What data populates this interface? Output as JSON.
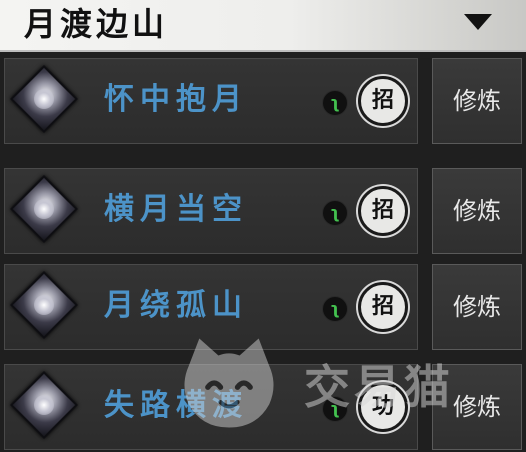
{
  "header": {
    "title": "月渡边山",
    "dropdown_icon": "triangle-down-icon"
  },
  "skills": [
    {
      "name": "怀中抱月",
      "badge": "招",
      "action": "修炼"
    },
    {
      "name": "横月当空",
      "badge": "招",
      "action": "修炼"
    },
    {
      "name": "月绕孤山",
      "badge": "招",
      "action": "修炼"
    },
    {
      "name": "失路横渡",
      "badge": "功",
      "action": "修炼"
    }
  ],
  "colors": {
    "skill_name": "#4c93c8",
    "tiny_icon": "#43c14f"
  },
  "watermark": {
    "text": "交易猫",
    "icon": "cat-logo-icon"
  }
}
